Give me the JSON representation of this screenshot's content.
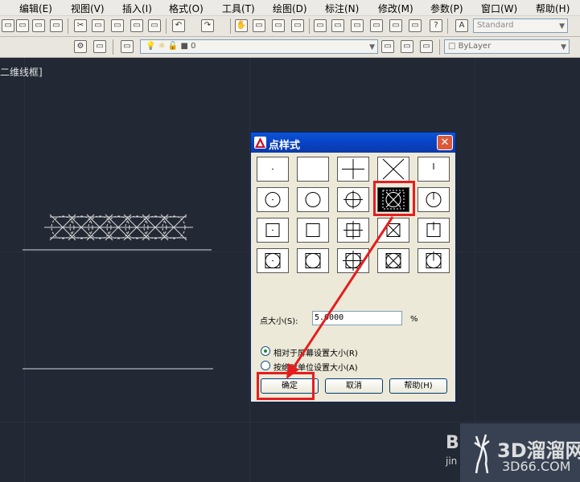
{
  "menu": [
    "编辑(E)",
    "视图(V)",
    "插入(I)",
    "格式(O)",
    "工具(T)",
    "绘图(D)",
    "标注(N)",
    "修改(M)",
    "参数(P)",
    "窗口(W)",
    "帮助(H)"
  ],
  "toolbar": {
    "text_style": "Standard",
    "layer_value": "0",
    "linetype": "ByLayer"
  },
  "viewport_label": "二维线框]",
  "dialog": {
    "title": "点样式",
    "close_glyph": "✕",
    "styles": [
      [
        "dot",
        "blank",
        "plus",
        "x",
        "tick"
      ],
      [
        "circle-dot",
        "circle",
        "circle-plus",
        "circle-x",
        "circle-tick"
      ],
      [
        "square-dot",
        "square",
        "square-plus",
        "square-x",
        "square-tick"
      ],
      [
        "cs-dot",
        "cs",
        "cs-plus",
        "cs-x",
        "cs-tick"
      ]
    ],
    "selected_style": "circle-x",
    "size_label": "点大小(S):",
    "size_value": "5.0000",
    "size_unit": "%",
    "radio_relative": "相对于屏幕设置大小(R)",
    "radio_absolute": "按绝对单位设置大小(A)",
    "selected_radio": "relative",
    "ok": "确定",
    "cancel": "取消",
    "help": "帮助(H)"
  },
  "watermark": {
    "title": "3D溜溜网",
    "url": "3D66.COM",
    "partial_left": "B",
    "partial_left2": "jin"
  },
  "colors": {
    "canvas": "#222834",
    "highlight": "#e41e1e",
    "titlebar": "#0842c5"
  }
}
